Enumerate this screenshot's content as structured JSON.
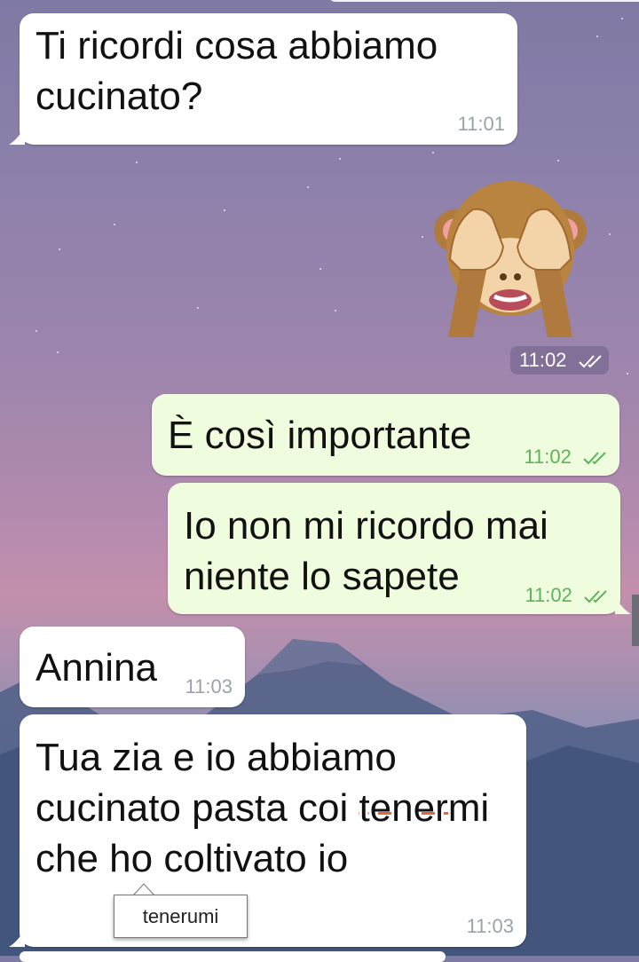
{
  "messages": [
    {
      "text": "Ti ricordi cosa abbiamo cucinato?",
      "time": "11:01",
      "direction": "incoming"
    },
    {
      "sticker": "see-no-evil-monkey",
      "time": "11:02",
      "direction": "outgoing",
      "status": "read"
    },
    {
      "text": "È così importante",
      "time": "11:02",
      "direction": "outgoing",
      "status": "read"
    },
    {
      "text": "Io non mi ricordo mai niente lo sapete",
      "time": "11:02",
      "direction": "outgoing",
      "status": "read"
    },
    {
      "text": "Annina",
      "time": "11:03",
      "direction": "incoming"
    },
    {
      "text_before": "Tua zia e io abbiamo cucinato pasta coi ",
      "misspelled": "tenermi",
      "text_after": " che ho coltivato io",
      "time": "11:03",
      "direction": "incoming"
    }
  ],
  "spell_suggestion": "tenerumi",
  "colors": {
    "incoming": "#ffffff",
    "outgoing": "#effdde",
    "outgoing_time": "#5db35a",
    "misspell_underline": "#e0673a"
  }
}
